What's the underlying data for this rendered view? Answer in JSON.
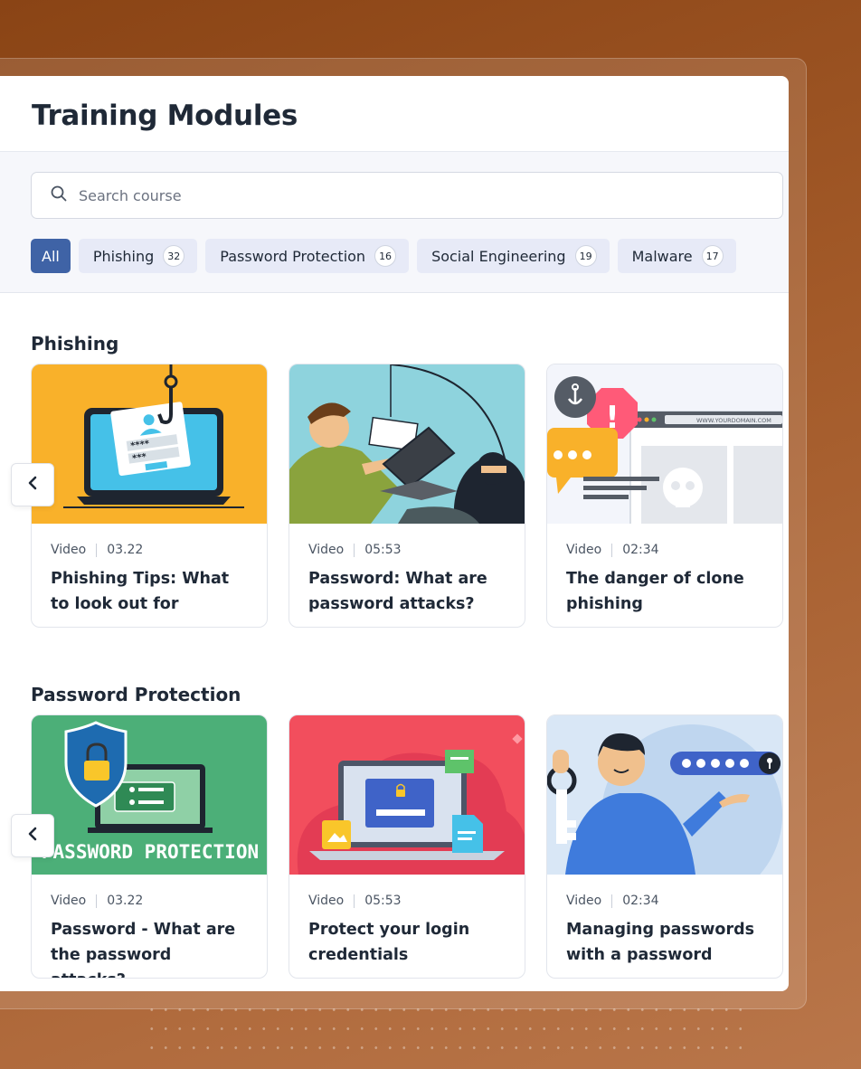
{
  "page": {
    "title": "Training Modules"
  },
  "search": {
    "placeholder": "Search course"
  },
  "filters": [
    {
      "label": "All",
      "count": null,
      "active": true
    },
    {
      "label": "Phishing",
      "count": "32"
    },
    {
      "label": "Password Protection",
      "count": "16"
    },
    {
      "label": "Social Engineering",
      "count": "19"
    },
    {
      "label": "Malware",
      "count": "17"
    }
  ],
  "sections": [
    {
      "title": "Phishing",
      "cards": [
        {
          "type": "Video",
          "duration": "03.22",
          "title": "Phishing Tips: What to look out for",
          "thumb": "laptop-login-fishhook"
        },
        {
          "type": "Video",
          "duration": "05:53",
          "title": "Password: What are password attacks?",
          "thumb": "hacker-fishing-password"
        },
        {
          "type": "Video",
          "duration": "02:34",
          "title": "The danger of clone phishing",
          "thumb": "clone-website-warning",
          "thumb_text": "WWW.YOURDOMAIN.COM"
        }
      ]
    },
    {
      "title": "Password Protection",
      "cards": [
        {
          "type": "Video",
          "duration": "03.22",
          "title": "Password - What are the password attacks?",
          "thumb": "shield-lock-laptop",
          "thumb_text": "PASSWORD PROTECTION"
        },
        {
          "type": "Video",
          "duration": "05:53",
          "title": "Protect your login credentials",
          "thumb": "secure-screen-files"
        },
        {
          "type": "Video",
          "duration": "02:34",
          "title": "Managing passwords with a password",
          "thumb": "man-with-key-password"
        }
      ]
    }
  ],
  "colors": {
    "accent": "#3f63a6",
    "chip_bg": "#e7eaf7",
    "background": "#8a4415"
  }
}
